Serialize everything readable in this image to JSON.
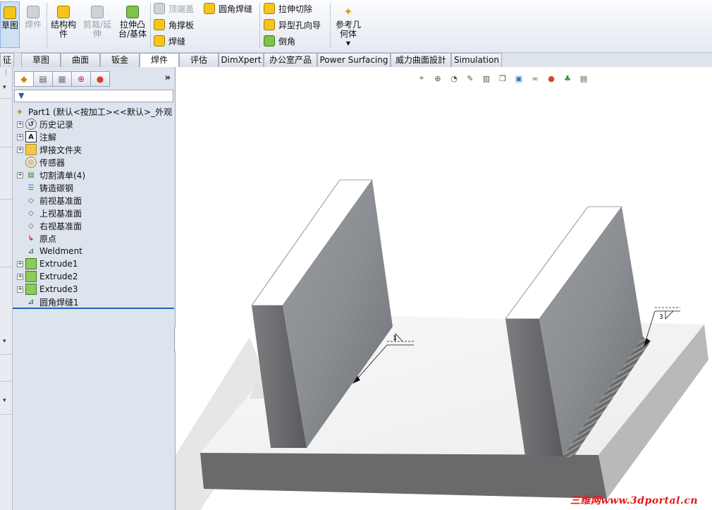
{
  "ribbon": {
    "sketch": "草图",
    "weldment": "焊件",
    "structural_member": "结构构件",
    "trim_extend": "剪裁/延伸",
    "extrude_boss": "拉伸凸台/基体",
    "end_cap": "顶端盖",
    "fillet_bead": "圆角焊缝",
    "gusset": "角撑板",
    "weld_bead": "焊缝",
    "extrude_cut": "拉伸切除",
    "hole_wizard": "异型孔向导",
    "chamfer": "倒角",
    "ref_geometry": "参考几何体"
  },
  "tabs": {
    "features": "征",
    "sketch": "草图",
    "surfaces": "曲面",
    "sheet_metal": "钣金",
    "weldments": "焊件",
    "evaluate": "评估",
    "dimxpert": "DimXpert",
    "office": "办公室产品",
    "power_surfacing": "Power Surfacing",
    "weili": "威力曲面設計",
    "simulation": "Simulation"
  },
  "panel": {
    "more": "»"
  },
  "tree": {
    "root": "Part1  (默认<按加工><<默认>_外观",
    "history": "历史记录",
    "annotations": "注解",
    "weld_folder": "焊接文件夹",
    "sensors": "传感器",
    "cut_list": "切割清单(4)",
    "material": "铸造碳钢",
    "front_plane": "前视基准面",
    "top_plane": "上视基准面",
    "right_plane": "右视基准面",
    "origin": "原点",
    "weldment": "Weldment",
    "extrude1": "Extrude1",
    "extrude2": "Extrude2",
    "extrude3": "Extrude3",
    "fillet_bead1": "圆角焊缝1"
  },
  "weld_symbols": {
    "left": "1",
    "right": "3"
  },
  "watermark": "三维网www.3dportal.cn",
  "colors": {
    "panel_bg": "#dde4ee",
    "selection": "#1f5fbf",
    "watermark": "#e11919"
  }
}
